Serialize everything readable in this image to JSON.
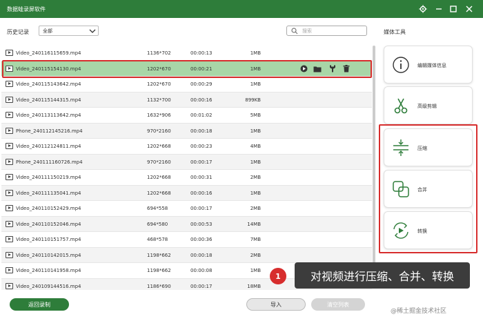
{
  "window": {
    "title": "数据蛙录屏软件",
    "controls": [
      "gear-icon",
      "minimize-icon",
      "maximize-icon",
      "close-icon"
    ]
  },
  "filter": {
    "label": "历史记录",
    "value": "全部"
  },
  "search": {
    "placeholder": "搜索"
  },
  "files": [
    {
      "name": "Video_240116115659.mp4",
      "resolution": "1136*702",
      "duration": "00:00:13",
      "size": "1MB"
    },
    {
      "name": "Video_240115154130.mp4",
      "resolution": "1202*670",
      "duration": "00:00:21",
      "size": "1MB",
      "selected": true
    },
    {
      "name": "Video_240115143642.mp4",
      "resolution": "1202*670",
      "duration": "00:00:29",
      "size": "1MB"
    },
    {
      "name": "Video_240115144315.mp4",
      "resolution": "1132*700",
      "duration": "00:00:16",
      "size": "899KB"
    },
    {
      "name": "Video_240113113642.mp4",
      "resolution": "1632*906",
      "duration": "00:01:02",
      "size": "5MB"
    },
    {
      "name": "Phone_240112145216.mp4",
      "resolution": "970*2160",
      "duration": "00:00:18",
      "size": "1MB"
    },
    {
      "name": "Video_240112124811.mp4",
      "resolution": "1202*668",
      "duration": "00:00:23",
      "size": "4MB"
    },
    {
      "name": "Phone_240111160726.mp4",
      "resolution": "970*2160",
      "duration": "00:00:17",
      "size": "1MB"
    },
    {
      "name": "Video_240111150219.mp4",
      "resolution": "1202*668",
      "duration": "00:00:31",
      "size": "2MB"
    },
    {
      "name": "Video_240111135041.mp4",
      "resolution": "1202*668",
      "duration": "00:00:16",
      "size": "1MB"
    },
    {
      "name": "Video_240110152429.mp4",
      "resolution": "694*558",
      "duration": "00:00:17",
      "size": "2MB"
    },
    {
      "name": "Video_240110152046.mp4",
      "resolution": "694*580",
      "duration": "00:00:53",
      "size": "14MB"
    },
    {
      "name": "Video_240110151757.mp4",
      "resolution": "468*578",
      "duration": "00:00:36",
      "size": "7MB"
    },
    {
      "name": "Video_240110142015.mp4",
      "resolution": "1198*662",
      "duration": "00:00:18",
      "size": "2MB"
    },
    {
      "name": "Video_240110141958.mp4",
      "resolution": "1198*662",
      "duration": "00:00:08",
      "size": "1MB"
    },
    {
      "name": "Video_240109144516.mp4",
      "resolution": "1186*690",
      "duration": "00:00:17",
      "size": "18MB"
    }
  ],
  "row_actions": [
    "play-icon",
    "folder-icon",
    "wrench-icon",
    "trash-icon"
  ],
  "tools": {
    "title": "媒体工具",
    "items": [
      {
        "label": "编辑媒体信息",
        "icon": "info-icon"
      },
      {
        "label": "高级剪辑",
        "icon": "scissors-icon"
      },
      {
        "label": "压缩",
        "icon": "compress-icon"
      },
      {
        "label": "合并",
        "icon": "merge-icon"
      },
      {
        "label": "转换",
        "icon": "convert-icon"
      }
    ]
  },
  "callout": {
    "number": "1",
    "text": "对视频进行压缩、合并、转换"
  },
  "buttons": {
    "back": "返回录制",
    "import": "导入",
    "clear": "清空列表"
  },
  "watermark": "@稀土掘金技术社区",
  "colors": {
    "accent": "#2e7d3a",
    "selected_row": "#a8d6a7",
    "highlight": "#d72d2d"
  }
}
